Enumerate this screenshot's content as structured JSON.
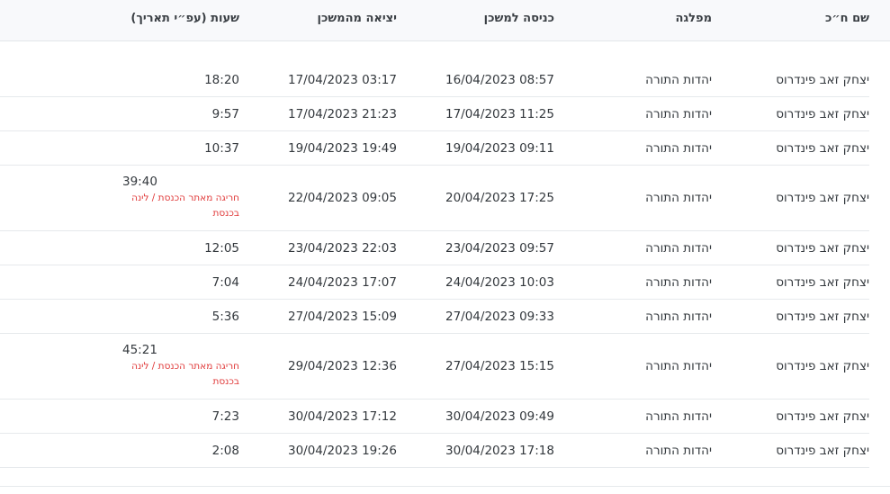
{
  "table": {
    "headers": {
      "name": "שם ח״כ",
      "department": "מפלגה",
      "entry": "כניסה למשכן",
      "exit": "יציאה מהמשכן",
      "hours": "שעות (עפ״י תאריך)"
    },
    "rows": [
      {
        "name": "יצחק זאב פינדרוס",
        "department": "יהדות התורה",
        "entry": "16/04/2023 08:57",
        "exit": "17/04/2023 03:17",
        "hours": "18:20",
        "note": ""
      },
      {
        "name": "יצחק זאב פינדרוס",
        "department": "יהדות התורה",
        "entry": "17/04/2023 11:25",
        "exit": "17/04/2023 21:23",
        "hours": "9:57",
        "note": ""
      },
      {
        "name": "יצחק זאב פינדרוס",
        "department": "יהדות התורה",
        "entry": "19/04/2023 09:11",
        "exit": "19/04/2023 19:49",
        "hours": "10:37",
        "note": ""
      },
      {
        "name": "יצחק זאב פינדרוס",
        "department": "יהדות התורה",
        "entry": "20/04/2023 17:25",
        "exit": "22/04/2023 09:05",
        "hours": "39:40",
        "note": "חריגה מאתר הכנסת / לינה בכנסת"
      },
      {
        "name": "יצחק זאב פינדרוס",
        "department": "יהדות התורה",
        "entry": "23/04/2023 09:57",
        "exit": "23/04/2023 22:03",
        "hours": "12:05",
        "note": ""
      },
      {
        "name": "יצחק זאב פינדרוס",
        "department": "יהדות התורה",
        "entry": "24/04/2023 10:03",
        "exit": "24/04/2023 17:07",
        "hours": "7:04",
        "note": ""
      },
      {
        "name": "יצחק זאב פינדרוס",
        "department": "יהדות התורה",
        "entry": "27/04/2023 09:33",
        "exit": "27/04/2023 15:09",
        "hours": "5:36",
        "note": ""
      },
      {
        "name": "יצחק זאב פינדרוס",
        "department": "יהדות התורה",
        "entry": "27/04/2023 15:15",
        "exit": "29/04/2023 12:36",
        "hours": "45:21",
        "note": "חריגה מאתר הכנסת / לינה בכנסת"
      },
      {
        "name": "יצחק זאב פינדרוס",
        "department": "יהדות התורה",
        "entry": "30/04/2023 09:49",
        "exit": "30/04/2023 17:12",
        "hours": "7:23",
        "note": ""
      },
      {
        "name": "יצחק זאב פינדרוס",
        "department": "יהדות התורה",
        "entry": "30/04/2023 17:18",
        "exit": "30/04/2023 19:26",
        "hours": "2:08",
        "note": ""
      }
    ]
  }
}
